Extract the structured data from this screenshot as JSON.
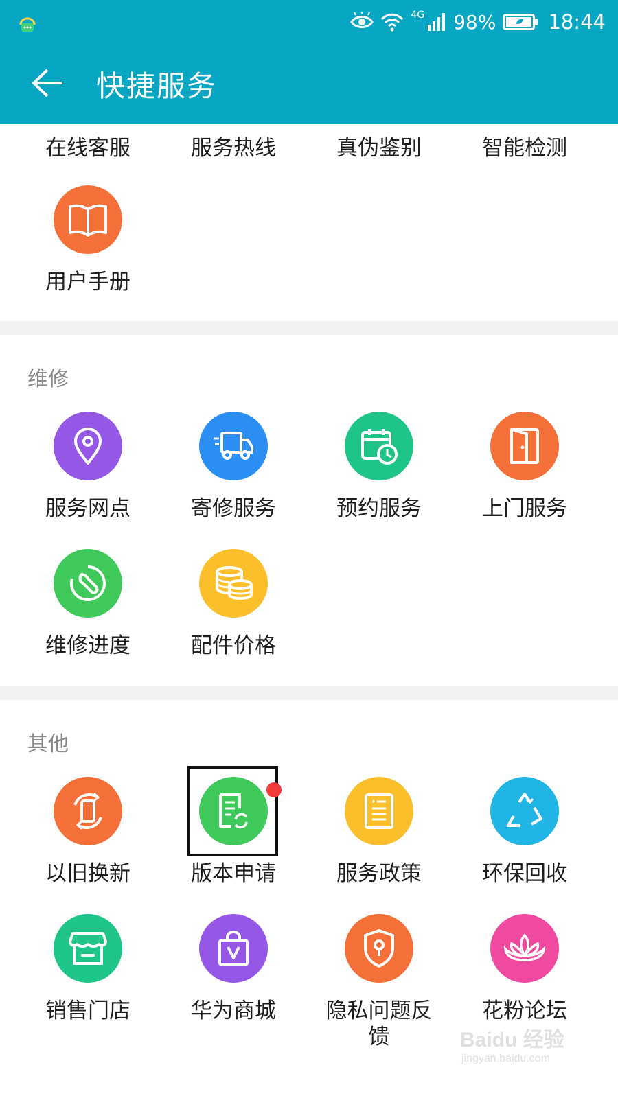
{
  "status_bar": {
    "battery_percent": "98%",
    "time": "18:44",
    "network": "4G",
    "icons": [
      "notification-icon",
      "eye-icon",
      "wifi-icon",
      "signal-icon",
      "battery-icon"
    ]
  },
  "app_bar": {
    "title": "快捷服务",
    "back_icon": "arrow-left-icon"
  },
  "top_row": {
    "items": [
      "在线客服",
      "服务热线",
      "真伪鉴别",
      "智能检测"
    ]
  },
  "general": {
    "items": [
      {
        "label": "用户手册",
        "icon": "book-icon",
        "color": "#f56f38"
      }
    ]
  },
  "repair": {
    "title": "维修",
    "items": [
      {
        "label": "服务网点",
        "icon": "location-pin-icon",
        "color": "#9457e6"
      },
      {
        "label": "寄修服务",
        "icon": "truck-icon",
        "color": "#2a8ef2"
      },
      {
        "label": "预约服务",
        "icon": "calendar-clock-icon",
        "color": "#1fc488"
      },
      {
        "label": "上门服务",
        "icon": "door-icon",
        "color": "#f56f38"
      },
      {
        "label": "维修进度",
        "icon": "wrench-icon",
        "color": "#3fc95a"
      },
      {
        "label": "配件价格",
        "icon": "coins-icon",
        "color": "#fbbf2c"
      }
    ]
  },
  "other": {
    "title": "其他",
    "items": [
      {
        "label": "以旧换新",
        "icon": "phone-exchange-icon",
        "color": "#f56f38"
      },
      {
        "label": "版本申请",
        "icon": "document-refresh-icon",
        "color": "#3fc95a",
        "badge": true
      },
      {
        "label": "服务政策",
        "icon": "policy-document-icon",
        "color": "#fbbf2c"
      },
      {
        "label": "环保回收",
        "icon": "recycle-icon",
        "color": "#21b5e6"
      },
      {
        "label": "销售门店",
        "icon": "store-icon",
        "color": "#1fc488"
      },
      {
        "label": "华为商城",
        "icon": "shopping-bag-icon",
        "color": "#9457e6"
      },
      {
        "label": "隐私问题反馈",
        "icon": "privacy-shield-icon",
        "color": "#f56f38"
      },
      {
        "label": "花粉论坛",
        "icon": "lotus-icon",
        "color": "#f04aa0"
      }
    ]
  },
  "watermark": {
    "brand": "Baidu 经验",
    "url": "jingyan.baidu.com"
  }
}
